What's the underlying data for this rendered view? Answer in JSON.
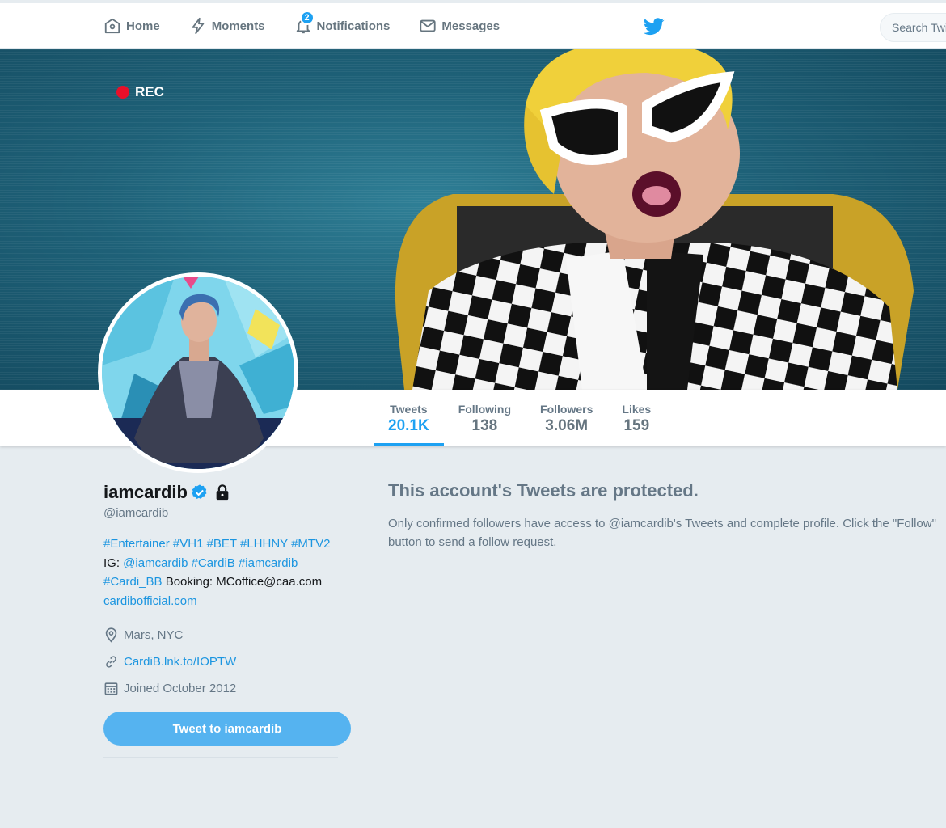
{
  "nav": {
    "items": [
      {
        "label": "Home",
        "icon": "home-icon"
      },
      {
        "label": "Moments",
        "icon": "lightning-icon"
      },
      {
        "label": "Notifications",
        "icon": "bell-icon",
        "badge": "2"
      },
      {
        "label": "Messages",
        "icon": "envelope-icon"
      }
    ],
    "search_placeholder": "Search Twi"
  },
  "banner": {
    "rec_label": "REC"
  },
  "stats": [
    {
      "label": "Tweets",
      "value": "20.1K",
      "active": true
    },
    {
      "label": "Following",
      "value": "138"
    },
    {
      "label": "Followers",
      "value": "3.06M"
    },
    {
      "label": "Likes",
      "value": "159"
    }
  ],
  "profile": {
    "name": "iamcardib",
    "screen_name": "@iamcardib",
    "bio": {
      "line1": "#Entertainer #VH1 #BET #LHHNY #MTV2",
      "line2_prefix": "IG: ",
      "line2_links": "@iamcardib #CardiB #iamcardib",
      "line3_link": "#Cardi_BB",
      "line3_text": " Booking: MCoffice@caa.com",
      "line4_link": "cardibofficial.com"
    },
    "location": "Mars, NYC",
    "url": "CardiB.lnk.to/IOPTW",
    "joined": "Joined October 2012",
    "tweet_to_label": "Tweet to iamcardib"
  },
  "protected": {
    "title": "This account's Tweets are protected.",
    "text": "Only confirmed followers have access to @iamcardib's Tweets and complete profile. Click the \"Follow\" button to send a follow request."
  },
  "colors": {
    "accent": "#1da1f2",
    "link": "#1b95e0",
    "background": "#e6ecf0"
  }
}
